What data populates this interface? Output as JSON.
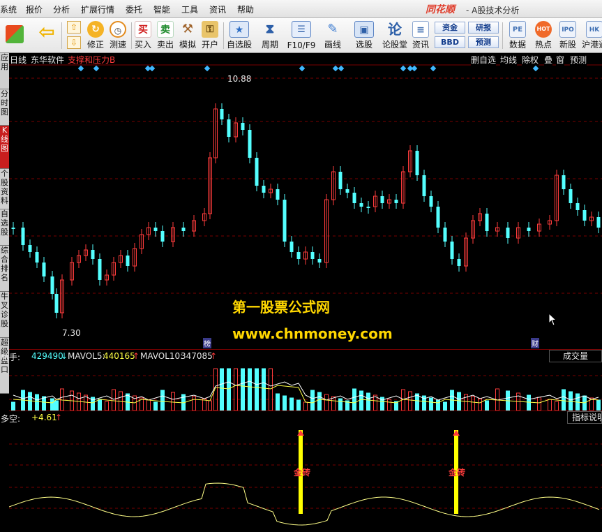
{
  "menubar": {
    "items": [
      "系统",
      "报价",
      "分析",
      "扩展行情",
      "委托",
      "智能",
      "工具",
      "资讯",
      "帮助"
    ],
    "brand": "同花顺",
    "subtitle": "- A股技术分析"
  },
  "toolbar": {
    "buttons": [
      {
        "label": "",
        "icon": "windows-icon",
        "color": "#e5461e"
      },
      {
        "label": "",
        "icon": "back-arrow-icon",
        "color": "#f0b400"
      },
      {
        "label": "修正",
        "icon": "adjust-icon",
        "color": "#e8a317"
      },
      {
        "label": "测速",
        "icon": "clock-icon",
        "color": "#e38b1c"
      },
      {
        "label": "买入",
        "icon": "buy-icon",
        "glyph": "买",
        "color": "#d02020"
      },
      {
        "label": "卖出",
        "icon": "sell-icon",
        "glyph": "卖",
        "color": "#1b8a2a"
      },
      {
        "label": "模拟",
        "icon": "hammer-icon",
        "color": "#a0642c"
      },
      {
        "label": "开户",
        "icon": "lock-icon",
        "color": "#c98d2b"
      },
      {
        "label": "自选股",
        "icon": "star-icon",
        "color": "#2b6cc4"
      },
      {
        "label": "周期",
        "icon": "period-icon",
        "color": "#2d5fa8"
      },
      {
        "label": "F10/F9",
        "icon": "f10-icon",
        "color": "#2d5fa8"
      },
      {
        "label": "画线",
        "icon": "pen-icon",
        "color": "#3c7bd0"
      },
      {
        "label": "选股",
        "icon": "screen-icon",
        "color": "#2d5fa8"
      },
      {
        "label": "论股堂",
        "icon": "forum-icon",
        "glyph": "论",
        "color": "#2d5fa8"
      },
      {
        "label": "资讯",
        "icon": "news-icon",
        "color": "#4d78b6"
      },
      {
        "label": "数据",
        "icon": "pe-icon",
        "glyph": "PE",
        "color": "#3e6fb3"
      },
      {
        "label": "热点",
        "icon": "hot-icon",
        "glyph": "HOT",
        "color": "#d64a1e"
      },
      {
        "label": "新股",
        "icon": "ipo-icon",
        "glyph": "IPO",
        "color": "#3e6fb3"
      },
      {
        "label": "沪港通",
        "icon": "hk-icon",
        "glyph": "HK",
        "color": "#3e6fb3"
      }
    ],
    "small_buttons": [
      "资金",
      "BBD",
      "研报",
      "预测"
    ]
  },
  "sidebar": {
    "tabs": [
      "应用",
      "分时图",
      "K线图",
      "个股资料",
      "自选股",
      "综合排名",
      "牛叉诊股",
      "超级盘口"
    ],
    "active": 2
  },
  "chart": {
    "period": "日线",
    "stock_name": "东华软件",
    "indicator_title": "支撑和压力B",
    "right_buttons": [
      "删自选",
      "均线",
      "除权",
      "叠",
      "窗",
      "预测"
    ],
    "high_label": "10.88",
    "low_label": "7.30",
    "event_marks": [
      "榜",
      "财"
    ],
    "volume_panel": {
      "label_total": "总手:",
      "total_value": "429490",
      "total_arrow": "↓",
      "mavol5_label": "MAVOL5:",
      "mavol5_value": "440165",
      "mavol5_arrow": "↑",
      "mavol10_label": "MAVOL10:",
      "mavol10_value": "347085",
      "mavol10_arrow": "↑",
      "button": "成交量"
    },
    "bs_panel": {
      "label": "多空:",
      "value": "+4.61",
      "arrow": "↑",
      "button": "指标说明",
      "signal_label": "金砖"
    }
  },
  "watermark": {
    "line1": "第一股票公式网",
    "line2": "www.chnmoney.com"
  },
  "colors": {
    "up": "#ff3c3c",
    "down": "#54ffff",
    "grid": "#7a0000",
    "diamond": "#3fb8ff",
    "signal": "#ffff00"
  }
}
